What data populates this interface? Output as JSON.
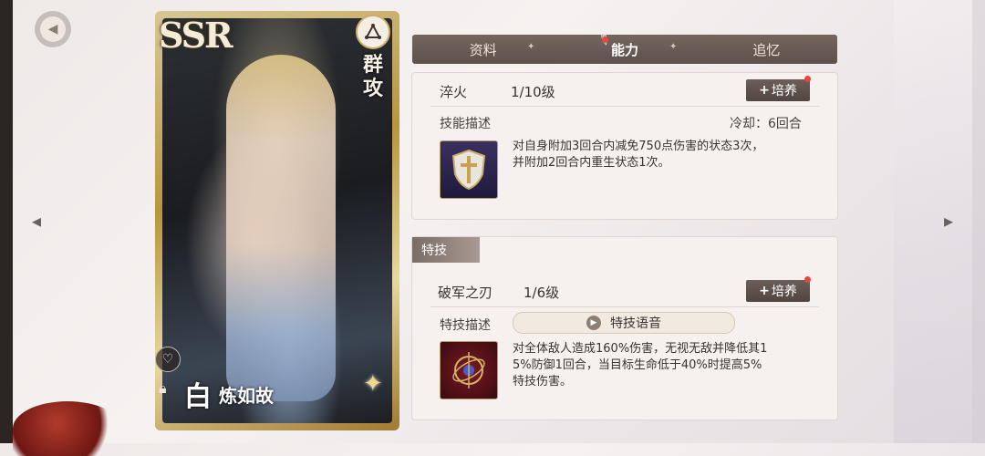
{
  "card": {
    "rarity": "SSR",
    "class_label": "群攻",
    "char_glyph": "白",
    "char_name": "炼如故"
  },
  "tabs": [
    {
      "label": "资料",
      "active": false
    },
    {
      "label": "能力",
      "active": true
    },
    {
      "label": "追忆",
      "active": false
    }
  ],
  "skill": {
    "name": "淬火",
    "level": "1/10级",
    "upgrade_label": "培养",
    "desc_label": "技能描述",
    "cooldown": "冷却：6回合",
    "desc_line1": "对自身附加3回合内减免750点伤害的状态3次，",
    "desc_line2": "并附加2回合内重生状态1次。"
  },
  "special": {
    "section_label": "特技",
    "name": "破军之刃",
    "level": "1/6级",
    "upgrade_label": "培养",
    "desc_label": "特技描述",
    "voice_label": "特技语音",
    "desc_line1": "对全体敌人造成160%伤害，无视无敌并降低其1",
    "desc_line2": "5%防御1回合，当目标生命低于40%时提高5%",
    "desc_line3": "特技伤害。"
  },
  "colors": {
    "accent_dark": "#5e514c",
    "notify_dot": "#e5473d",
    "card_gold": "#c9ad6a"
  },
  "icons": [
    "back-icon",
    "arrow-left-icon",
    "arrow-right-icon",
    "heart-icon",
    "lock-icon",
    "pen-icon",
    "shield-cross-icon",
    "blade-orb-icon",
    "play-icon",
    "class-icon"
  ]
}
